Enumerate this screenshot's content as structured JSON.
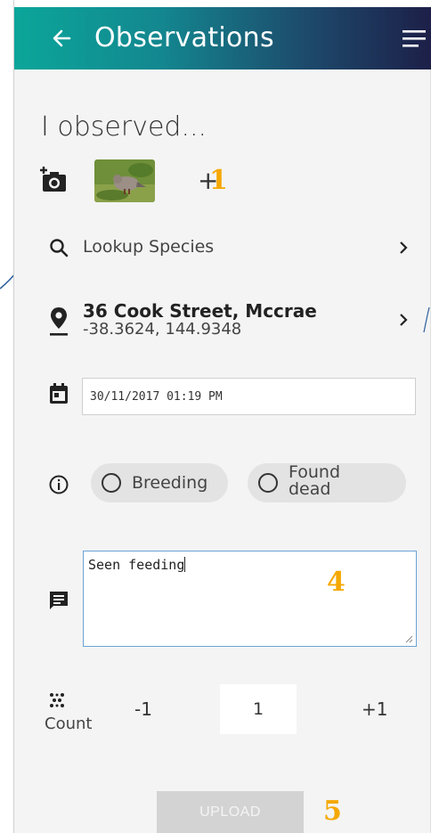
{
  "header": {
    "title": "Observations",
    "back_icon": "arrow-left-icon",
    "menu_icon": "menu-icon",
    "gradient": [
      "#0ba69a",
      "#1d1f48"
    ]
  },
  "form": {
    "heading": "I observed...",
    "photos": {
      "camera_icon": "add-photo-icon",
      "extra_count": "+",
      "annotation": "1"
    },
    "species": {
      "icon": "search-icon",
      "label": "Lookup Species"
    },
    "location": {
      "icon": "location-pin-icon",
      "address": "36 Cook Street, Mccrae",
      "coords": "-38.3624, 144.9348"
    },
    "date": {
      "icon": "calendar-icon",
      "value": "30/11/2017 01:19 PM"
    },
    "status": {
      "icon": "info-icon",
      "options": [
        "Breeding",
        "Found dead"
      ]
    },
    "notes": {
      "icon": "comment-icon",
      "value": "Seen feeding",
      "annotation": "4"
    },
    "count": {
      "icon": "count-dots-icon",
      "label": "Count",
      "decrement": "-1",
      "value": "1",
      "increment": "+1"
    },
    "upload": {
      "label": "UPLOAD",
      "annotation": "5"
    }
  },
  "colors": {
    "accent": "#0ba69a",
    "annotation": "#f5a800",
    "focus_border": "#6aa3d8"
  }
}
